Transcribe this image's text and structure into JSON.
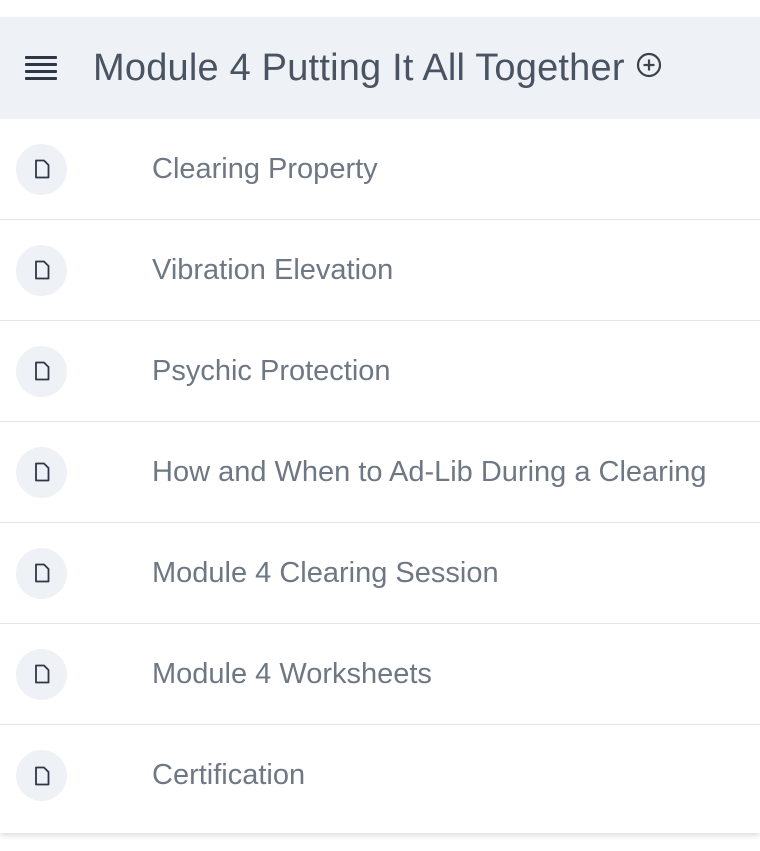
{
  "header": {
    "title": "Module 4 Putting It All Together",
    "menu_icon": "hamburger-menu-icon",
    "add_icon": "plus-circle-icon"
  },
  "lessons": [
    {
      "label": "Clearing Property",
      "icon": "document-icon"
    },
    {
      "label": "Vibration Elevation",
      "icon": "document-icon"
    },
    {
      "label": "Psychic Protection",
      "icon": "document-icon"
    },
    {
      "label": "How and When to Ad-Lib During a Clearing",
      "icon": "document-icon"
    },
    {
      "label": "Module 4 Clearing Session",
      "icon": "document-icon"
    },
    {
      "label": "Module 4 Worksheets",
      "icon": "document-icon"
    },
    {
      "label": "Certification",
      "icon": "document-icon"
    }
  ],
  "colors": {
    "header_bg": "#eef1f5",
    "title_text": "#4a5361",
    "row_text": "#6e7784",
    "divider": "#e2e6ec"
  }
}
